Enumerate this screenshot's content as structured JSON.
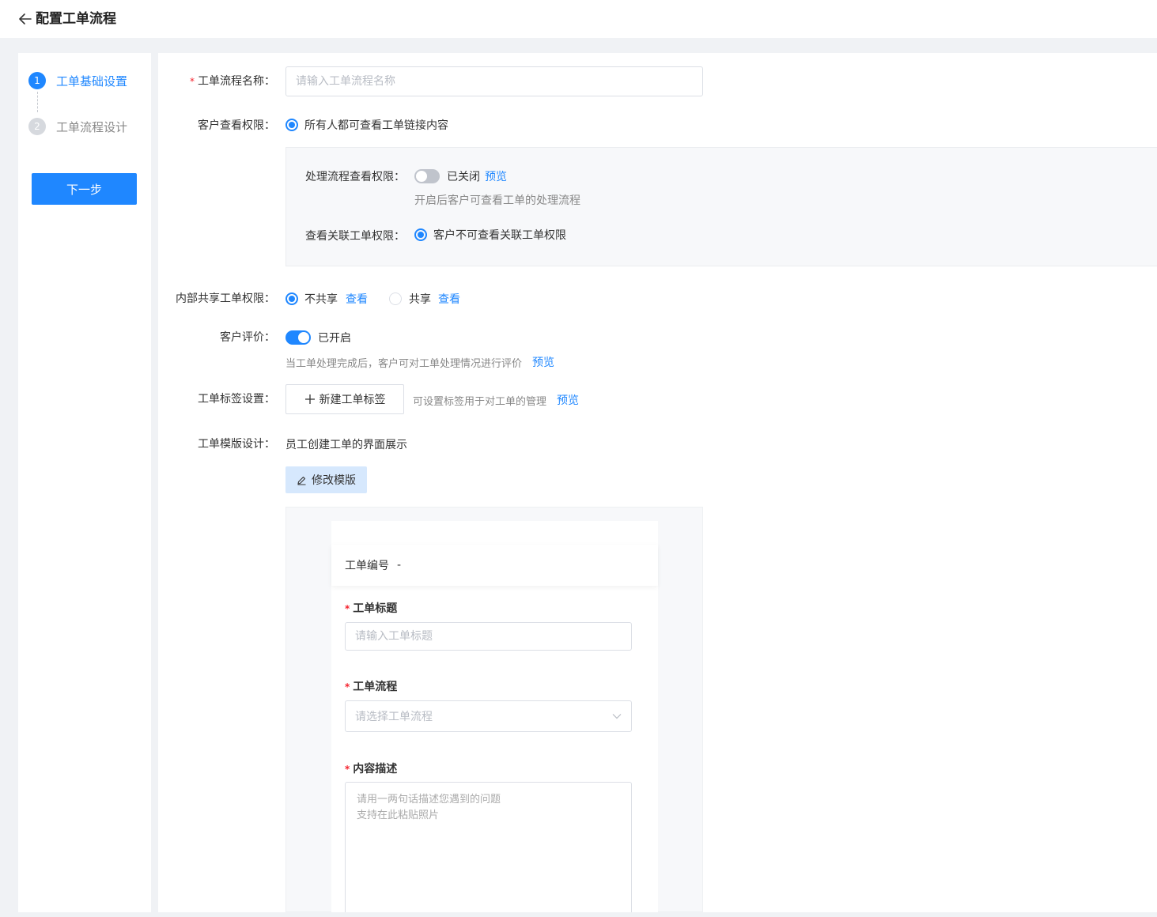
{
  "header": {
    "title": "配置工单流程"
  },
  "steps": [
    {
      "num": "1",
      "label": "工单基础设置"
    },
    {
      "num": "2",
      "label": "工单流程设计"
    }
  ],
  "next_label": "下一步",
  "form": {
    "name": {
      "label": "工单流程名称：",
      "placeholder": "请输入工单流程名称"
    },
    "customer_view": {
      "label": "客户查看权限：",
      "option": "所有人都可查看工单链接内容"
    },
    "process_view": {
      "label": "处理流程查看权限：",
      "state": "已关闭",
      "link": "预览",
      "hint": "开启后客户可查看工单的处理流程"
    },
    "related_view": {
      "label": "查看关联工单权限：",
      "option": "客户不可查看关联工单权限"
    },
    "internal_share": {
      "label": "内部共享工单权限：",
      "options": [
        {
          "label": "不共享",
          "link": "查看"
        },
        {
          "label": "共享",
          "link": "查看"
        }
      ]
    },
    "rating": {
      "label": "客户评价：",
      "state": "已开启",
      "hint": "当工单处理完成后，客户可对工单处理情况进行评价",
      "link": "预览"
    },
    "tags": {
      "label": "工单标签设置：",
      "button": "新建工单标签",
      "hint": "可设置标签用于对工单的管理",
      "link": "预览"
    },
    "template": {
      "label": "工单模版设计：",
      "desc": "员工创建工单的界面展示",
      "edit_button": "修改模版"
    }
  },
  "preview": {
    "ticket_no_label": "工单编号",
    "ticket_no_value": "-",
    "title_label": "工单标题",
    "title_placeholder": "请输入工单标题",
    "flow_label": "工单流程",
    "flow_placeholder": "请选择工单流程",
    "desc_label": "内容描述",
    "desc_placeholder": "请用一两句话描述您遇到的问题\n支持在此粘贴照片"
  },
  "colors": {
    "primary": "#1f87ff",
    "required": "#f5222d"
  }
}
